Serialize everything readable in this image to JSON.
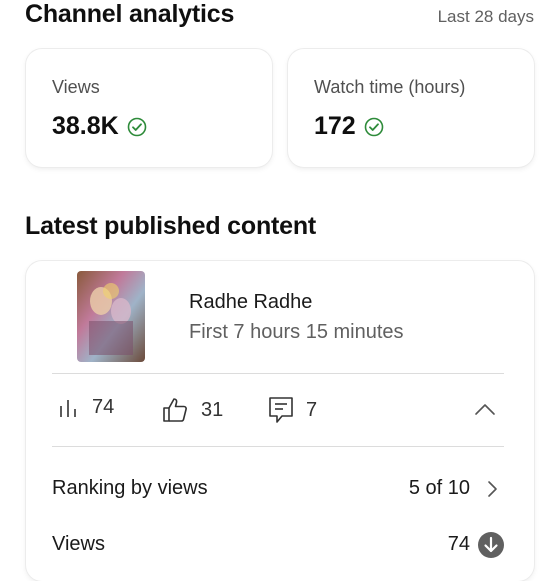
{
  "header": {
    "title": "Channel analytics",
    "period": "Last 28 days"
  },
  "stats": [
    {
      "label": "Views",
      "value": "38.8K",
      "status_icon": "check-circle-icon"
    },
    {
      "label": "Watch time (hours)",
      "value": "172",
      "status_icon": "check-circle-icon"
    }
  ],
  "latest": {
    "heading": "Latest published content",
    "video": {
      "title": "Radhe Radhe",
      "subtitle": "First 7 hours 15 minutes",
      "thumbnail_icon": "video-thumbnail"
    },
    "metrics": {
      "views": "74",
      "likes": "31",
      "comments": "7"
    },
    "ranking": {
      "label": "Ranking by views",
      "value": "5 of 10"
    },
    "views_row": {
      "label": "Views",
      "value": "74"
    }
  },
  "colors": {
    "check_green": "#2e8b3a",
    "down_icon_bg": "#606060",
    "text_secondary": "#606060"
  }
}
